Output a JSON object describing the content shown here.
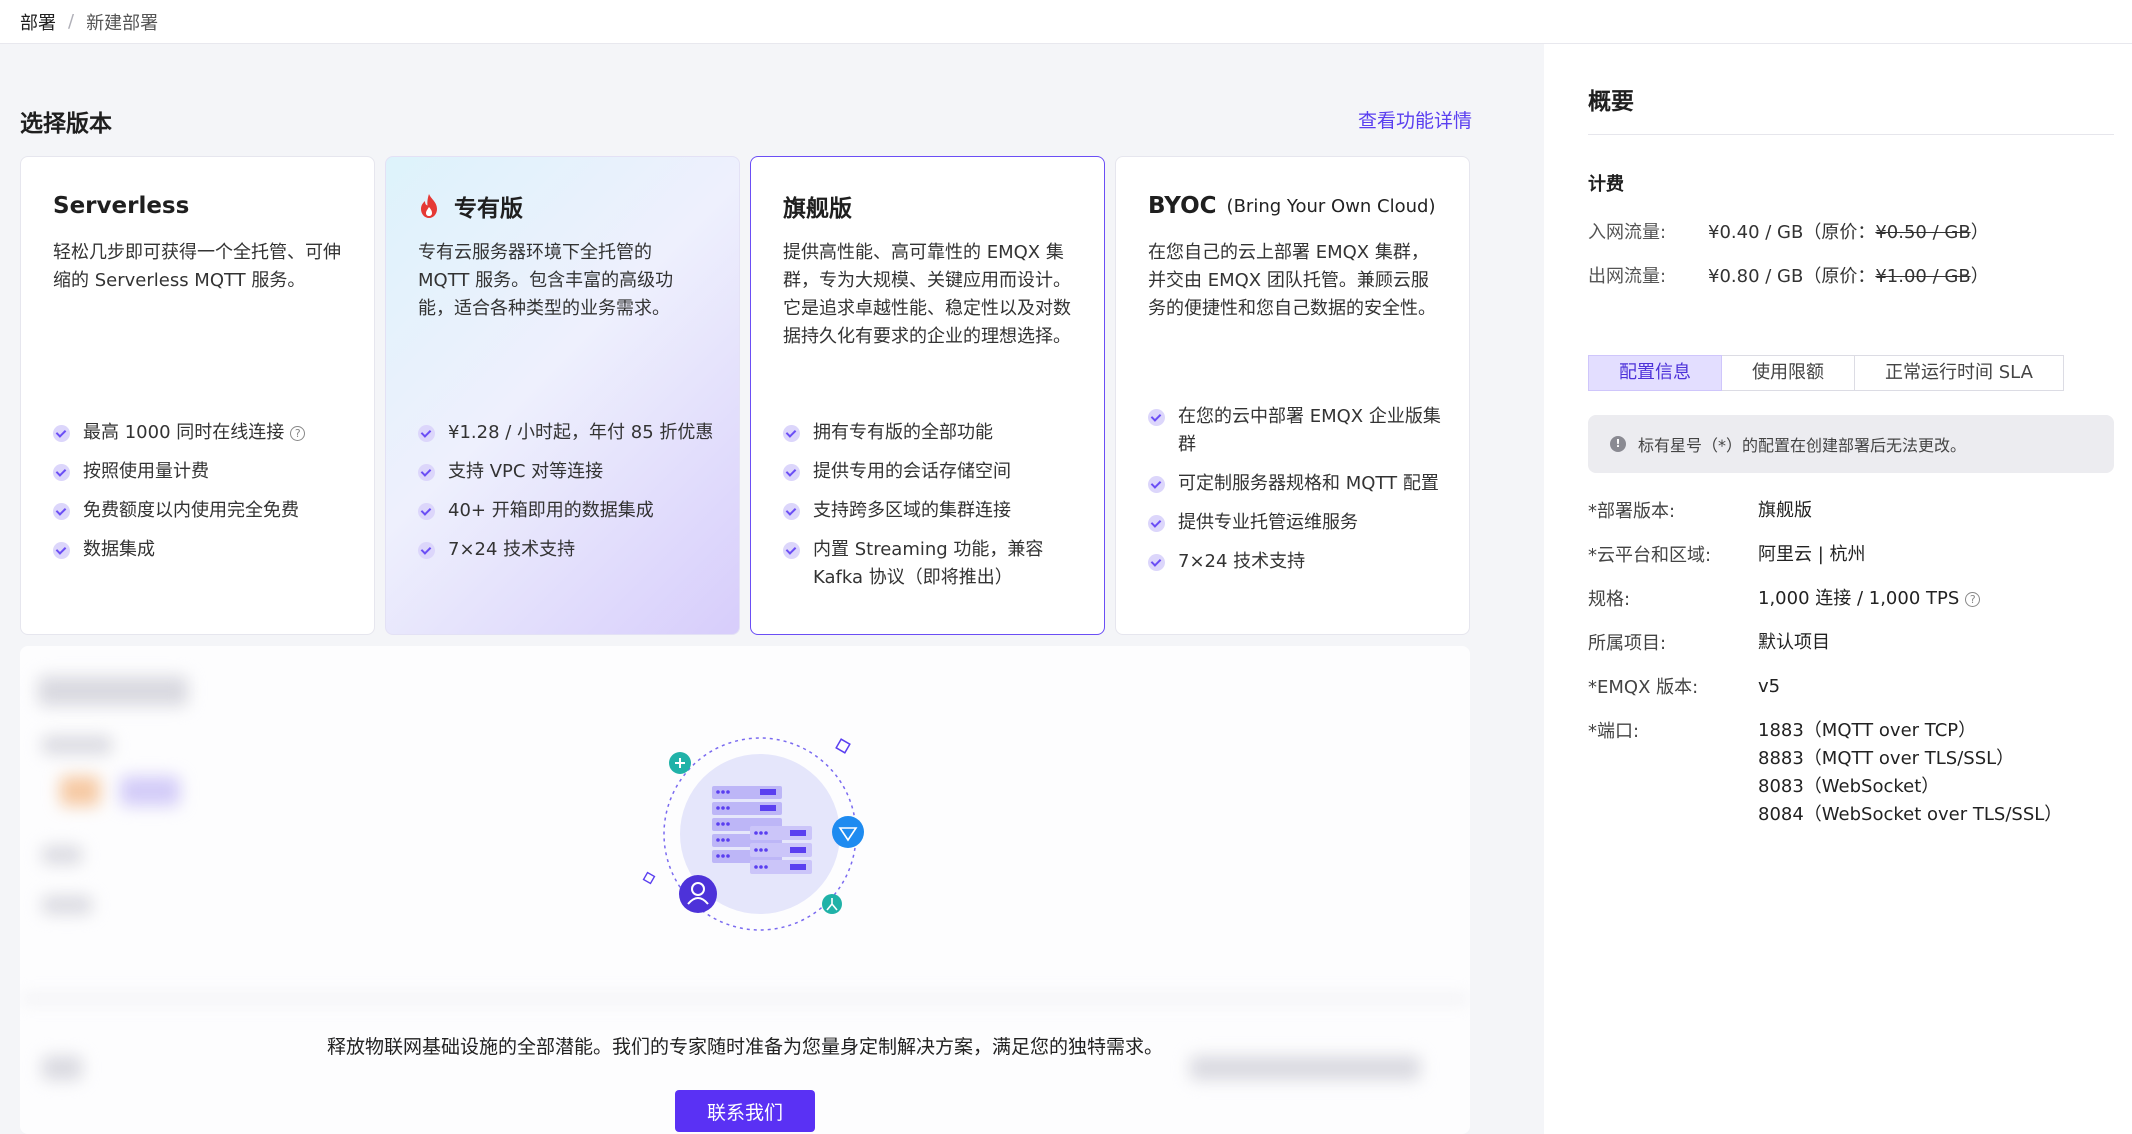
{
  "breadcrumb": {
    "root": "部署",
    "separator": "/",
    "current": "新建部署"
  },
  "main": {
    "section_title": "选择版本",
    "feature_link": "查看功能详情",
    "plans": [
      {
        "title": "Serverless",
        "desc": "轻松几步即可获得一个全托管、可伸缩的 Serverless MQTT 服务。",
        "features": [
          "最高 1000 同时在线连接",
          "按照使用量计费",
          "免费额度以内使用完全免费",
          "数据集成"
        ]
      },
      {
        "title": "专有版",
        "desc": "专有云服务器环境下全托管的 MQTT 服务。包含丰富的高级功能，适合各种类型的业务需求。",
        "features": [
          "¥1.28 / 小时起，年付 85 折优惠",
          "支持 VPC 对等连接",
          "40+ 开箱即用的数据集成",
          "7×24 技术支持"
        ]
      },
      {
        "title": "旗舰版",
        "desc": "提供高性能、高可靠性的 EMQX 集群，专为大规模、关键应用而设计。它是追求卓越性能、稳定性以及对数据持久化有要求的企业的理想选择。",
        "features": [
          "拥有专有版的全部功能",
          "提供专用的会话存储空间",
          "支持跨多区域的集群连接",
          "内置 Streaming 功能，兼容 Kafka 协议（即将推出）"
        ]
      },
      {
        "title": "BYOC",
        "subtitle": "(Bring Your Own Cloud)",
        "desc": "在您自己的云上部署 EMQX 集群，并交由 EMQX 团队托管。兼顾云服务的便捷性和您自己数据的安全性。",
        "features": [
          "在您的云中部署 EMQX 企业版集群",
          "可定制服务器规格和 MQTT 配置",
          "提供专业托管运维服务",
          "7×24 技术支持"
        ]
      }
    ],
    "cta": {
      "text": "释放物联网基础设施的全部潜能。我们的专家随时准备为您量身定制解决方案，满足您的独特需求。",
      "button": "联系我们"
    }
  },
  "summary": {
    "title": "概要",
    "billing_title": "计费",
    "inbound": {
      "label": "入网流量:",
      "price": "¥0.40 / GB（原价：",
      "original": "¥0.50 / GB",
      "close": "）"
    },
    "outbound": {
      "label": "出网流量:",
      "price": "¥0.80 / GB（原价：",
      "original": "¥1.00 / GB",
      "close": "）"
    },
    "tabs": [
      "配置信息",
      "使用限额",
      "正常运行时间 SLA"
    ],
    "notice": "标有星号（*）的配置在创建部署后无法更改。",
    "config": {
      "edition": {
        "label": "*部署版本:",
        "value": "旗舰版"
      },
      "region": {
        "label": "*云平台和区域:",
        "value": "阿里云 | 杭州"
      },
      "spec": {
        "label": "规格:",
        "value": "1,000 连接 / 1,000 TPS"
      },
      "project": {
        "label": "所属项目:",
        "value": "默认项目"
      },
      "version": {
        "label": "*EMQX 版本:",
        "value": "v5"
      },
      "ports": {
        "label": "*端口:",
        "values": [
          "1883（MQTT over TCP）",
          "8883（MQTT over TLS/SSL）",
          "8083（WebSocket）",
          "8084（WebSocket over TLS/SSL）"
        ]
      }
    }
  },
  "colors": {
    "accent": "#5a31f4",
    "selected_border": "#6b4ef5",
    "check_bg": "#dcd6fb"
  },
  "icons": [
    "flame-icon",
    "check-icon",
    "help-icon",
    "info-icon",
    "server-illustration"
  ]
}
